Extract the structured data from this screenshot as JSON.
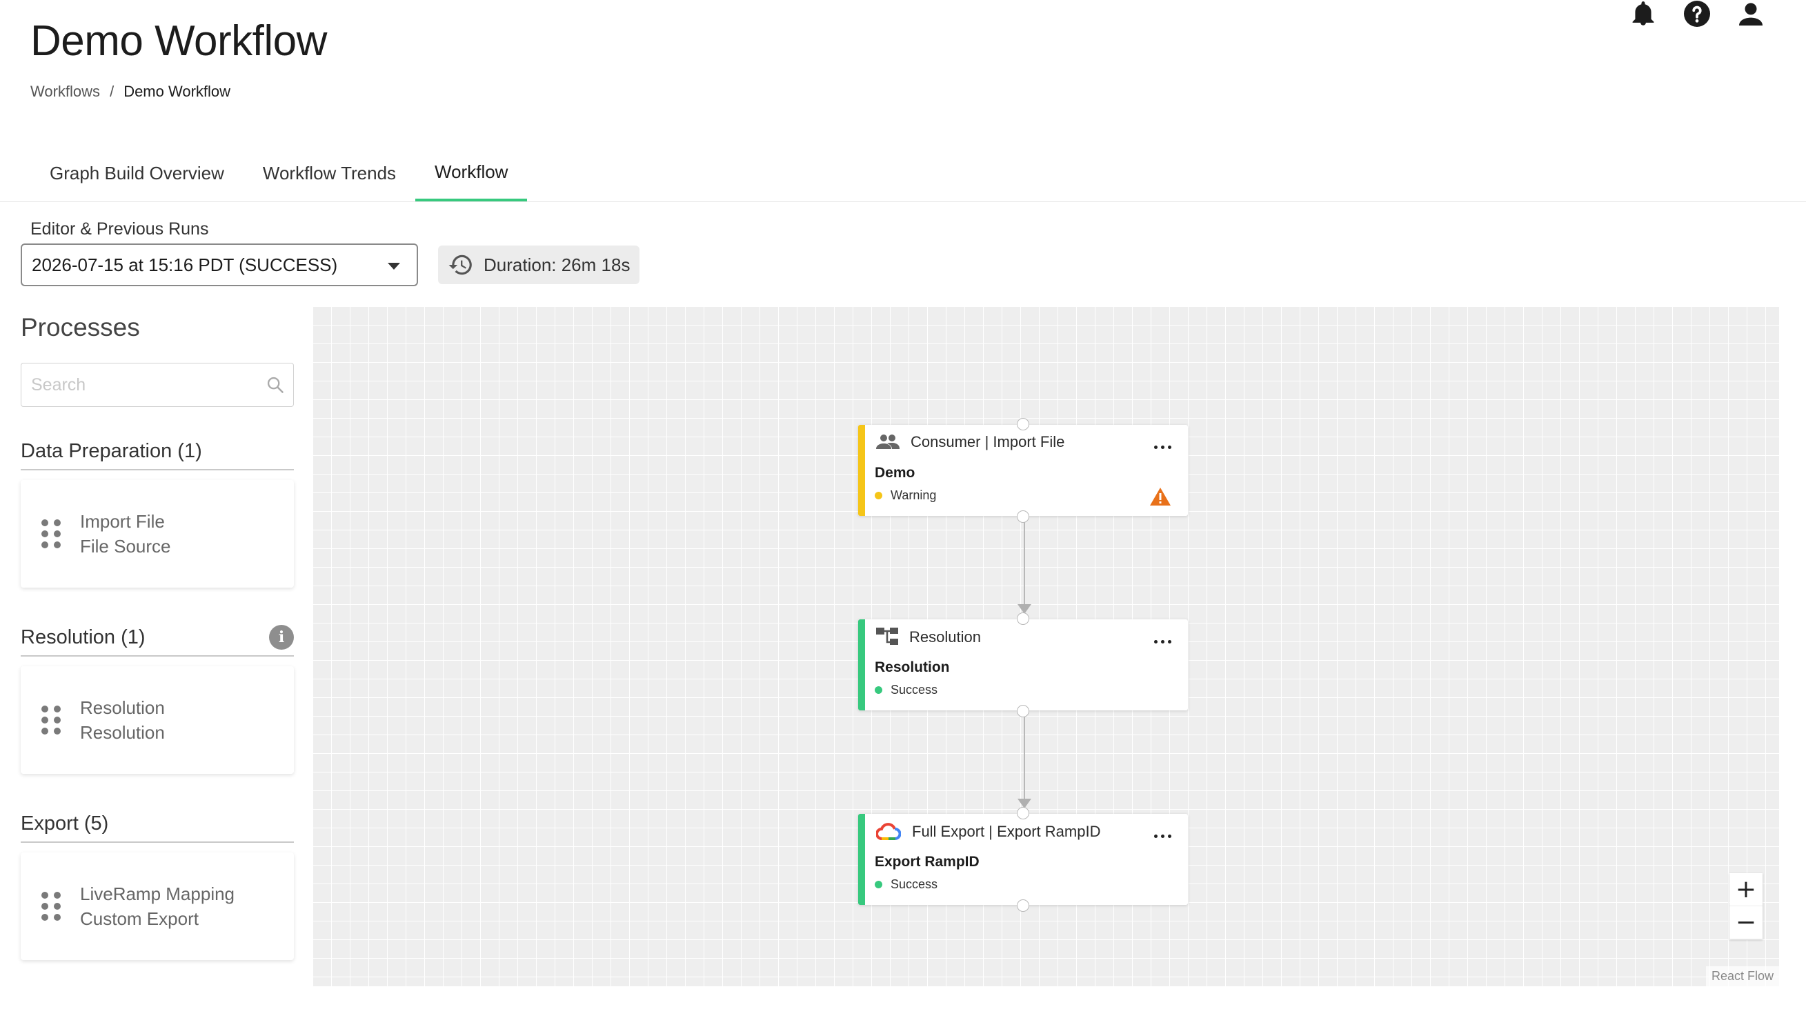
{
  "page": {
    "title": "Demo Workflow",
    "breadcrumb": {
      "root": "Workflows",
      "separator": "/",
      "current": "Demo Workflow"
    }
  },
  "header_icons": [
    "bell-icon",
    "help-icon",
    "user-icon"
  ],
  "tabs": [
    {
      "label": "Graph Build Overview",
      "active": false
    },
    {
      "label": "Workflow Trends",
      "active": false
    },
    {
      "label": "Workflow",
      "active": true
    }
  ],
  "runs": {
    "label": "Editor & Previous Runs",
    "selected": "2026-07-15 at 15:16 PDT (SUCCESS)",
    "duration": "Duration: 26m 18s"
  },
  "sidebar": {
    "title": "Processes",
    "search_placeholder": "Search",
    "groups": [
      {
        "title": "Data Preparation (1)",
        "lines": [
          "Import File",
          "File Source"
        ]
      },
      {
        "title": "Resolution (1)",
        "lines": [
          "Resolution",
          "Resolution"
        ],
        "has_info": true
      },
      {
        "title": "Export (5)",
        "lines": [
          "LiveRamp Mapping",
          "Custom Export"
        ]
      }
    ]
  },
  "nodes": [
    {
      "header": "Consumer | Import File",
      "name": "Demo",
      "status": "Warning",
      "status_color": "#f5c518",
      "accent_color": "#f5c518",
      "icon": "users-icon",
      "has_warning_icon": true
    },
    {
      "header": "Resolution",
      "name": "Resolution",
      "status": "Success",
      "status_color": "#37c97e",
      "accent_color": "#37c97e",
      "icon": "hierarchy-icon",
      "has_warning_icon": false
    },
    {
      "header": "Full Export | Export RampID",
      "name": "Export RampID",
      "status": "Success",
      "status_color": "#37c97e",
      "accent_color": "#37c97e",
      "icon": "google-cloud-icon",
      "has_warning_icon": false
    }
  ],
  "zoom": {
    "in": "+",
    "out": "−"
  },
  "attribution": "React Flow",
  "colors": {
    "accent_green": "#37c97e",
    "warning_yellow": "#f5c518",
    "warning_orange": "#e8711a"
  }
}
